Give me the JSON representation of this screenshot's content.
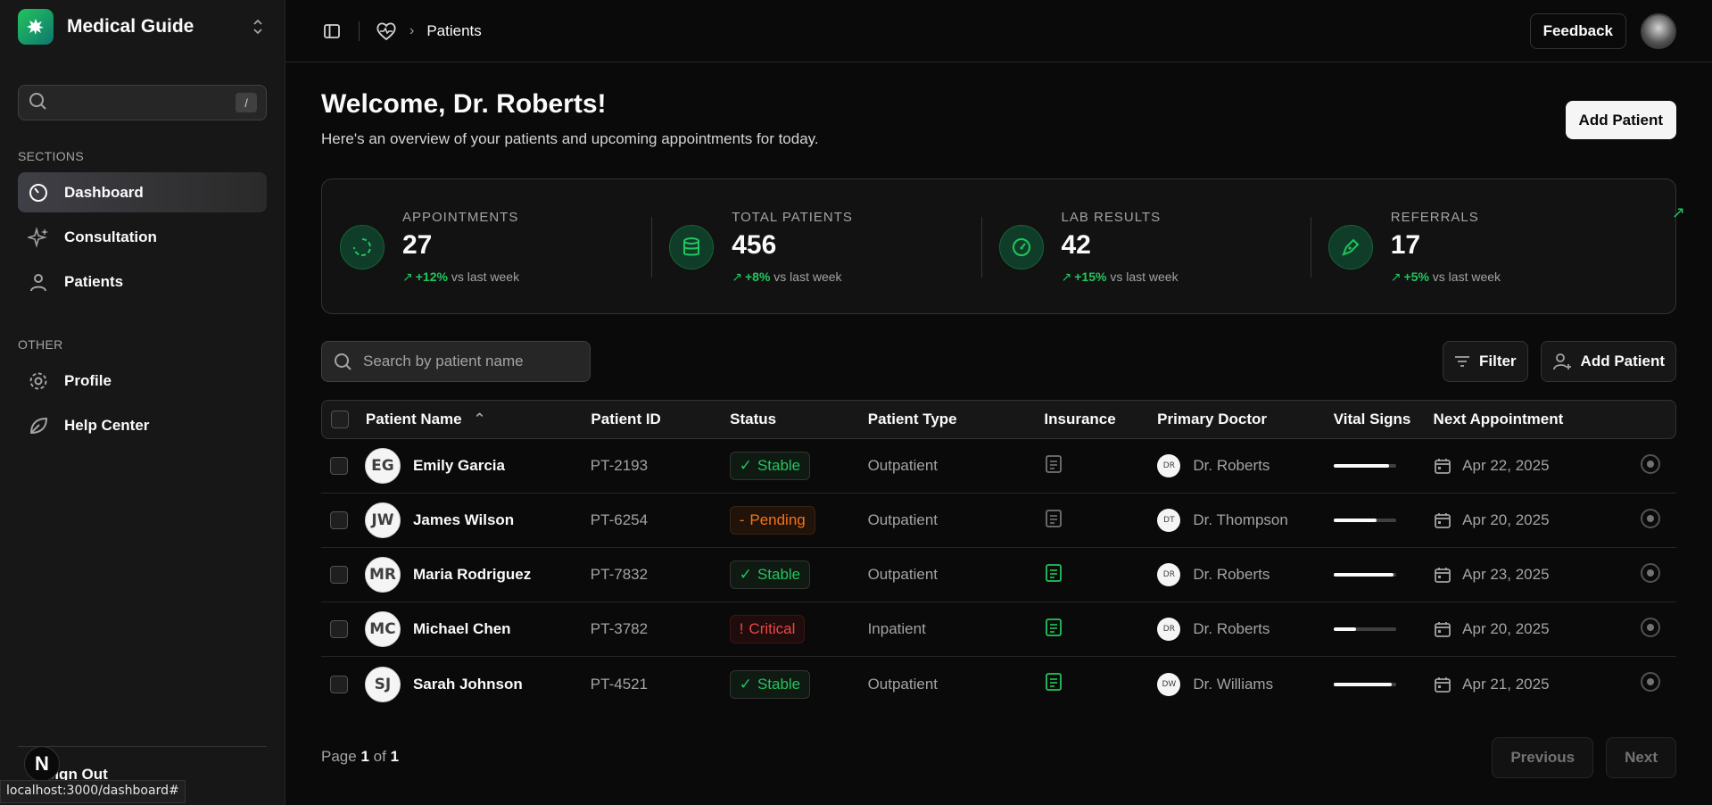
{
  "sidebar": {
    "brand": "Medical Guide",
    "search_shortcut": "/",
    "sections_label": "SECTIONS",
    "sections": [
      {
        "label": "Dashboard",
        "icon": "dashboard-icon",
        "active": true
      },
      {
        "label": "Consultation",
        "icon": "sparkles-icon"
      },
      {
        "label": "Patients",
        "icon": "user-icon"
      }
    ],
    "other_label": "OTHER",
    "other": [
      {
        "label": "Profile",
        "icon": "gear-icon"
      },
      {
        "label": "Help Center",
        "icon": "leaf-icon"
      }
    ],
    "sign_out": "Sign Out",
    "dev_badge": "N",
    "status_url": "localhost:3000/dashboard#"
  },
  "topbar": {
    "breadcrumb": "Patients",
    "feedback": "Feedback"
  },
  "welcome": {
    "title": "Welcome, Dr. Roberts!",
    "subtitle": "Here's an overview of your patients and upcoming appointments for today.",
    "add_patient": "Add Patient"
  },
  "stats": [
    {
      "label": "APPOINTMENTS",
      "value": "27",
      "trend": "+12%",
      "trend_suffix": "vs last week",
      "icon": "refresh-circle-icon"
    },
    {
      "label": "TOTAL PATIENTS",
      "value": "456",
      "trend": "+8%",
      "trend_suffix": "vs last week",
      "icon": "database-icon"
    },
    {
      "label": "LAB RESULTS",
      "value": "42",
      "trend": "+15%",
      "trend_suffix": "vs last week",
      "icon": "gauge-icon"
    },
    {
      "label": "REFERRALS",
      "value": "17",
      "trend": "+5%",
      "trend_suffix": "vs last week",
      "icon": "pen-icon"
    }
  ],
  "table_toolbar": {
    "search_placeholder": "Search by patient name",
    "filter": "Filter",
    "add_patient": "Add Patient"
  },
  "table": {
    "headers": [
      "Patient Name",
      "Patient ID",
      "Status",
      "Patient Type",
      "Insurance",
      "Primary Doctor",
      "Vital Signs",
      "Next Appointment"
    ],
    "rows": [
      {
        "initials": "EG",
        "name": "Emily Garcia",
        "id": "PT-2193",
        "status": "Stable",
        "type": "Outpatient",
        "insurance": false,
        "doctor_initials": "DR",
        "doctor": "Dr. Roberts",
        "vitals": 0.88,
        "appointment": "Apr 22, 2025"
      },
      {
        "initials": "JW",
        "name": "James Wilson",
        "id": "PT-6254",
        "status": "Pending",
        "type": "Outpatient",
        "insurance": false,
        "doctor_initials": "DT",
        "doctor": "Dr. Thompson",
        "vitals": 0.68,
        "appointment": "Apr 20, 2025"
      },
      {
        "initials": "MR",
        "name": "Maria Rodriguez",
        "id": "PT-7832",
        "status": "Stable",
        "type": "Outpatient",
        "insurance": true,
        "doctor_initials": "DR",
        "doctor": "Dr. Roberts",
        "vitals": 0.95,
        "appointment": "Apr 23, 2025"
      },
      {
        "initials": "MC",
        "name": "Michael Chen",
        "id": "PT-3782",
        "status": "Critical",
        "type": "Inpatient",
        "insurance": true,
        "doctor_initials": "DR",
        "doctor": "Dr. Roberts",
        "vitals": 0.35,
        "appointment": "Apr 20, 2025"
      },
      {
        "initials": "SJ",
        "name": "Sarah Johnson",
        "id": "PT-4521",
        "status": "Stable",
        "type": "Outpatient",
        "insurance": true,
        "doctor_initials": "DW",
        "doctor": "Dr. Williams",
        "vitals": 0.92,
        "appointment": "Apr 21, 2025"
      }
    ]
  },
  "pagination": {
    "prefix": "Page",
    "current": "1",
    "of": "of",
    "total": "1",
    "previous": "Previous",
    "next": "Next"
  },
  "colors": {
    "accent": "#22c55e",
    "pending": "#f97316",
    "critical": "#ef4444"
  }
}
